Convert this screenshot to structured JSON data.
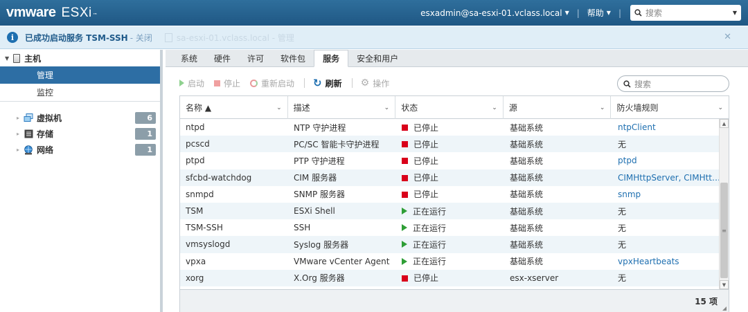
{
  "header": {
    "logo_vm": "vmware",
    "logo_product": "ESXi",
    "logo_tm": "™",
    "user": "esxadmin@sa-esxi-01.vclass.local",
    "help": "帮助",
    "search_placeholder": "搜索"
  },
  "notification": {
    "message": "已成功启动服务 TSM-SSH",
    "close_link": "- 关闭",
    "ghost_text": "sa-esxi-01.vclass.local - 管理"
  },
  "sidebar": {
    "host_label": "主机",
    "manage": "管理",
    "monitor": "监控",
    "nodes": [
      {
        "label": "虚拟机",
        "count": "6"
      },
      {
        "label": "存储",
        "count": "1"
      },
      {
        "label": "网络",
        "count": "1"
      }
    ]
  },
  "tabs": [
    "系统",
    "硬件",
    "许可",
    "软件包",
    "服务",
    "安全和用户"
  ],
  "active_tab": "服务",
  "toolbar": {
    "start": "启动",
    "stop": "停止",
    "restart": "重新启动",
    "refresh": "刷新",
    "actions": "操作"
  },
  "service_search_placeholder": "搜索",
  "grid": {
    "columns": [
      "名称 ▲",
      "描述",
      "状态",
      "源",
      "防火墙规则"
    ],
    "rows": [
      {
        "name": "ntpd",
        "desc": "NTP 守护进程",
        "status": "已停止",
        "running": false,
        "source": "基础系统",
        "firewall": "ntpClient",
        "fw_link": true
      },
      {
        "name": "pcscd",
        "desc": "PC/SC 智能卡守护进程",
        "status": "已停止",
        "running": false,
        "source": "基础系统",
        "firewall": "无",
        "fw_link": false
      },
      {
        "name": "ptpd",
        "desc": "PTP 守护进程",
        "status": "已停止",
        "running": false,
        "source": "基础系统",
        "firewall": "ptpd",
        "fw_link": true
      },
      {
        "name": "sfcbd-watchdog",
        "desc": "CIM 服务器",
        "status": "已停止",
        "running": false,
        "source": "基础系统",
        "firewall": "CIMHttpServer, CIMHtt…",
        "fw_link": true
      },
      {
        "name": "snmpd",
        "desc": "SNMP 服务器",
        "status": "已停止",
        "running": false,
        "source": "基础系统",
        "firewall": "snmp",
        "fw_link": true
      },
      {
        "name": "TSM",
        "desc": "ESXi Shell",
        "status": "正在运行",
        "running": true,
        "source": "基础系统",
        "firewall": "无",
        "fw_link": false
      },
      {
        "name": "TSM-SSH",
        "desc": "SSH",
        "status": "正在运行",
        "running": true,
        "source": "基础系统",
        "firewall": "无",
        "fw_link": false
      },
      {
        "name": "vmsyslogd",
        "desc": "Syslog 服务器",
        "status": "正在运行",
        "running": true,
        "source": "基础系统",
        "firewall": "无",
        "fw_link": false
      },
      {
        "name": "vpxa",
        "desc": "VMware vCenter Agent",
        "status": "正在运行",
        "running": true,
        "source": "基础系统",
        "firewall": "vpxHeartbeats",
        "fw_link": true
      },
      {
        "name": "xorg",
        "desc": "X.Org 服务器",
        "status": "已停止",
        "running": false,
        "source": "esx-xserver",
        "firewall": "无",
        "fw_link": false
      }
    ],
    "footer_count": "15 项"
  },
  "colors": {
    "header": "#1f5784",
    "selected": "#2d6ea4",
    "link": "#1e6fb0",
    "stopped": "#d9001b",
    "running": "#2e9e36"
  }
}
